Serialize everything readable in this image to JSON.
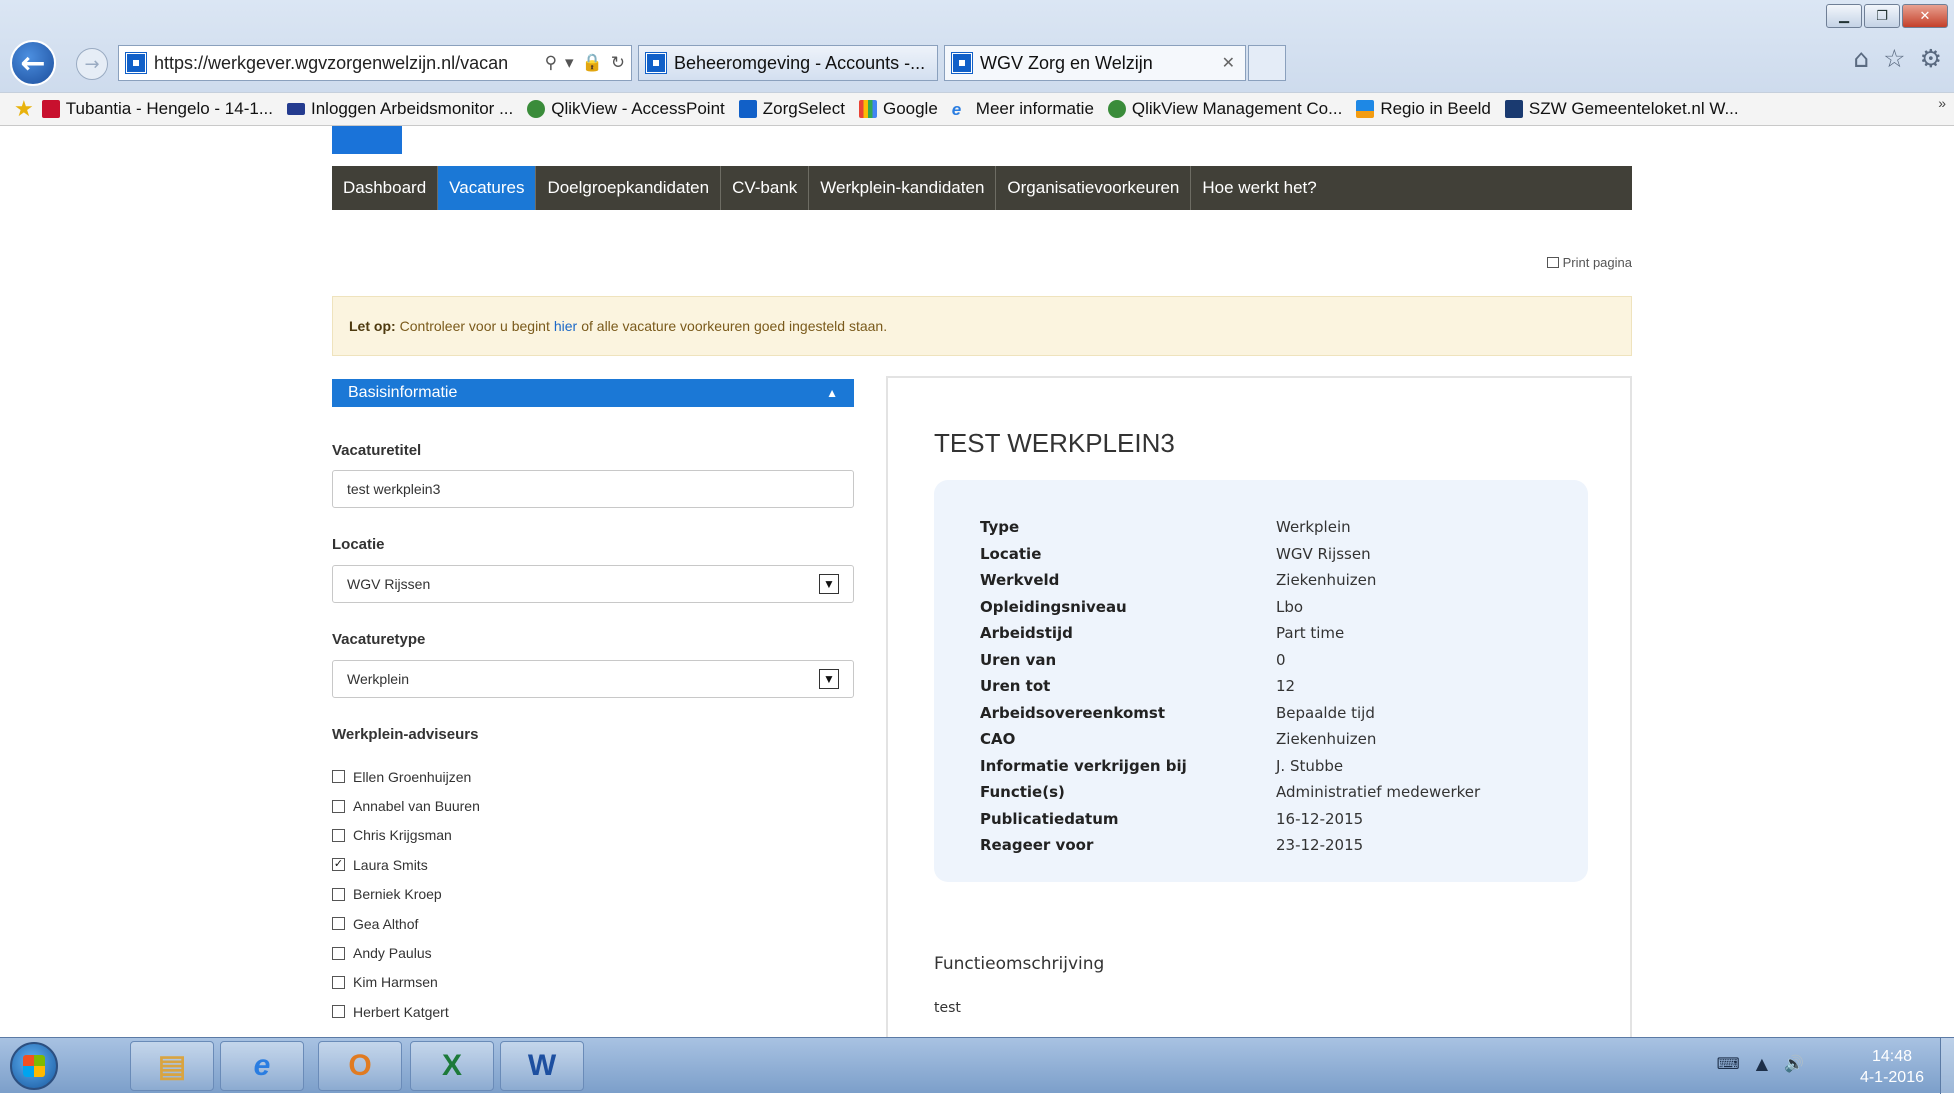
{
  "browser": {
    "address_url": "https://werkgever.wgvzorgenwelzijn.nl/vacan",
    "tabs": [
      {
        "label": "Beheeromgeving - Accounts -..."
      },
      {
        "label": "WGV Zorg en Welzijn"
      }
    ],
    "favorites": [
      {
        "label": "Tubantia - Hengelo - 14-1...",
        "icon": "tubantia-icon",
        "color": "#c8102e"
      },
      {
        "label": "Inloggen Arbeidsmonitor ...",
        "icon": "arbeidsmonitor-icon",
        "color": "#243b8f"
      },
      {
        "label": "QlikView - AccessPoint",
        "icon": "qlikview-icon",
        "color": "#3a8c3a"
      },
      {
        "label": "ZorgSelect",
        "icon": "zorgselect-icon",
        "color": "#1160c8"
      },
      {
        "label": "Google",
        "icon": "google-icon",
        "color": "#4285f4"
      },
      {
        "label": "Meer informatie",
        "icon": "ie-icon",
        "color": "#2a7de1"
      },
      {
        "label": "QlikView Management Co...",
        "icon": "qlikview-icon",
        "color": "#3a8c3a"
      },
      {
        "label": "Regio in Beeld",
        "icon": "regio-icon",
        "color": "#1e88e5"
      },
      {
        "label": "SZW Gemeenteloket.nl W...",
        "icon": "szw-icon",
        "color": "#1a3a70"
      }
    ]
  },
  "nav": {
    "items": [
      {
        "label": "Dashboard",
        "active": false
      },
      {
        "label": "Vacatures",
        "active": true
      },
      {
        "label": "Doelgroepkandidaten",
        "active": false
      },
      {
        "label": "CV-bank",
        "active": false
      },
      {
        "label": "Werkplein-kandidaten",
        "active": false
      },
      {
        "label": "Organisatievoorkeuren",
        "active": false
      },
      {
        "label": "Hoe werkt het?",
        "active": false
      }
    ]
  },
  "print_label": "Print pagina",
  "alert": {
    "strong": "Let op:",
    "before": "Controleer voor u begint",
    "link": "hier",
    "after": "of alle vacature voorkeuren goed ingesteld staan."
  },
  "form": {
    "section_title": "Basisinformatie",
    "vacaturetitel_label": "Vacaturetitel",
    "vacaturetitel_value": "test werkplein3",
    "locatie_label": "Locatie",
    "locatie_value": "WGV Rijssen",
    "vacaturetype_label": "Vacaturetype",
    "vacaturetype_value": "Werkplein",
    "adviseurs_label": "Werkplein-adviseurs",
    "adviseurs": [
      {
        "name": "Ellen Groenhuijzen",
        "checked": false
      },
      {
        "name": "Annabel van Buuren",
        "checked": false
      },
      {
        "name": "Chris Krijgsman",
        "checked": false
      },
      {
        "name": "Laura Smits",
        "checked": true
      },
      {
        "name": "Berniek Kroep",
        "checked": false
      },
      {
        "name": "Gea Althof",
        "checked": false
      },
      {
        "name": "Andy Paulus",
        "checked": false
      },
      {
        "name": "Kim Harmsen",
        "checked": false
      },
      {
        "name": "Herbert Katgert",
        "checked": false
      }
    ]
  },
  "detail": {
    "title": "TEST WERKPLEIN3",
    "rows": [
      {
        "key": "Type",
        "value": "Werkplein"
      },
      {
        "key": "Locatie",
        "value": "WGV Rijssen"
      },
      {
        "key": "Werkveld",
        "value": "Ziekenhuizen"
      },
      {
        "key": "Opleidingsniveau",
        "value": "Lbo"
      },
      {
        "key": "Arbeidstijd",
        "value": "Part time"
      },
      {
        "key": "Uren van",
        "value": "0"
      },
      {
        "key": "Uren tot",
        "value": "12"
      },
      {
        "key": "Arbeidsovereenkomst",
        "value": "Bepaalde tijd"
      },
      {
        "key": "CAO",
        "value": "Ziekenhuizen"
      },
      {
        "key": "Informatie verkrijgen bij",
        "value": "J. Stubbe"
      },
      {
        "key": "Functie(s)",
        "value": "Administratief medewerker"
      },
      {
        "key": "Publicatiedatum",
        "value": "16-12-2015"
      },
      {
        "key": "Reageer voor",
        "value": "23-12-2015"
      }
    ],
    "func_label": "Functieomschrijving",
    "func_text": "test"
  },
  "taskbar": {
    "apps": [
      {
        "name": "explorer",
        "letter": "▤",
        "color": "#d9a441"
      },
      {
        "name": "internet-explorer",
        "letter": "e",
        "color": "#2a7de1"
      },
      {
        "name": "outlook",
        "letter": "O",
        "color": "#e07b22"
      },
      {
        "name": "excel",
        "letter": "X",
        "color": "#1d7a3a"
      },
      {
        "name": "word",
        "letter": "W",
        "color": "#1d4fa0"
      }
    ],
    "time": "14:48",
    "date": "4-1-2016"
  },
  "colors": {
    "nav_bg": "#414038",
    "accent": "#1b78d6",
    "alert_bg": "#fbf4df",
    "info_bg": "#eef4fc"
  }
}
